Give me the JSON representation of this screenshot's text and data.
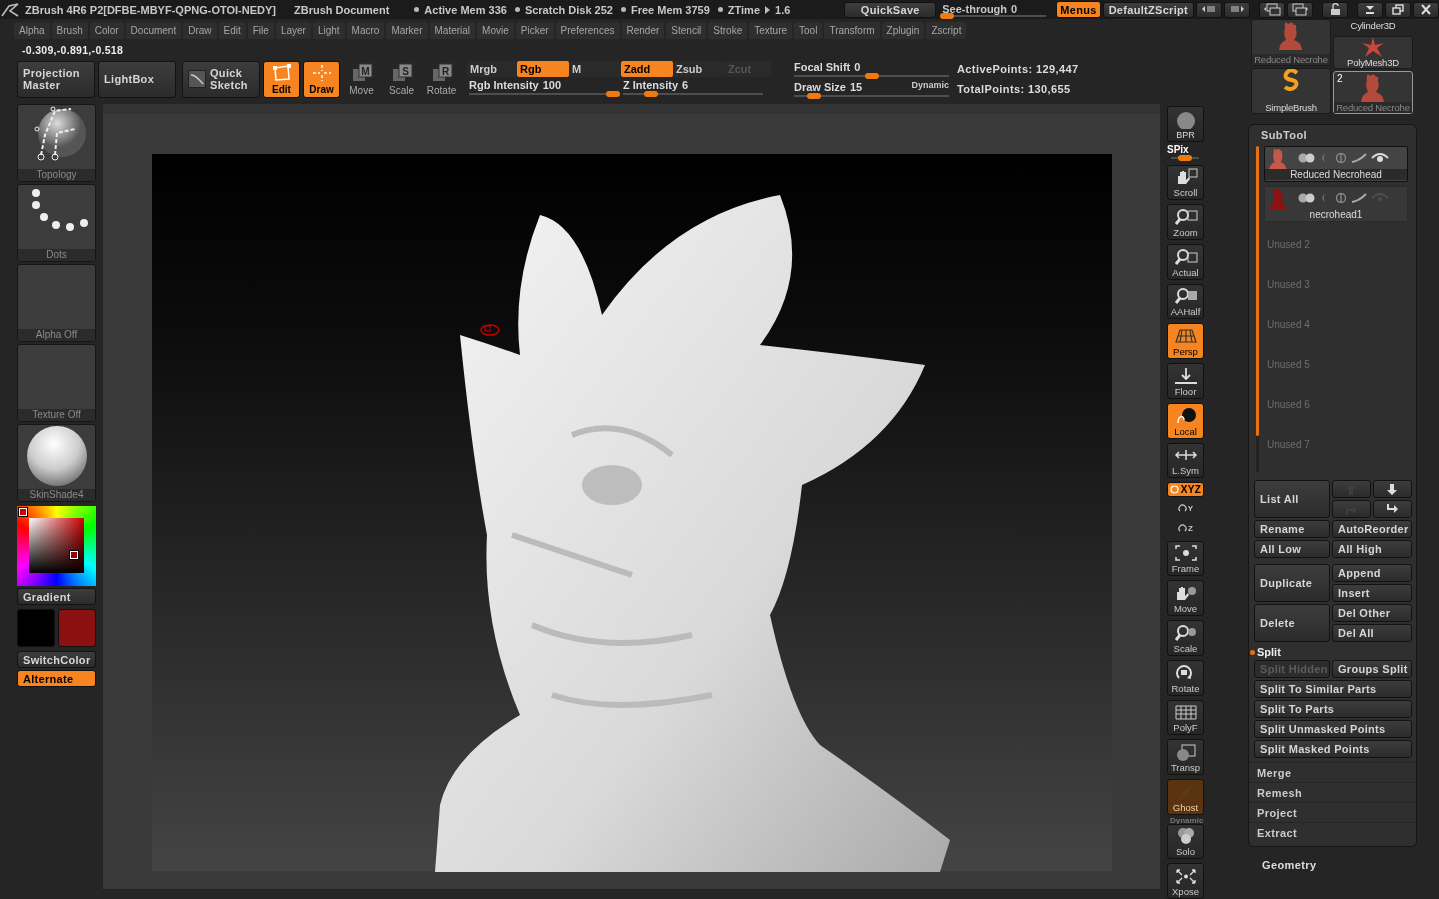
{
  "title_bar": {
    "title": "ZBrush 4R6 P2[DFBE-MBYF-QPNG-OTOI-NEDY]",
    "document": "ZBrush Document",
    "stats": [
      "Active Mem 336",
      "Scratch Disk 252",
      "Free Mem 3759",
      "ZTime"
    ],
    "ztime_value": "1.6",
    "quicksave": "QuickSave",
    "see_through": {
      "label": "See-through",
      "value": "0",
      "level": 0.05
    },
    "menus": {
      "label": "Menus",
      "on": true
    },
    "zscript": "DefaultZScript"
  },
  "menu_bar": [
    "Alpha",
    "Brush",
    "Color",
    "Document",
    "Draw",
    "Edit",
    "File",
    "Layer",
    "Light",
    "Macro",
    "Marker",
    "Material",
    "Movie",
    "Picker",
    "Preferences",
    "Render",
    "Stencil",
    "Stroke",
    "Texture",
    "Tool",
    "Transform",
    "Zplugin",
    "Zscript"
  ],
  "coordinates": "-0.309,-0.891,-0.518",
  "toolbar": {
    "big_buttons": [
      {
        "label": "Projection Master",
        "kind": "projection"
      },
      {
        "label": "LightBox",
        "kind": "lightbox"
      },
      {
        "label": "Quick Sketch",
        "kind": "sketch"
      }
    ],
    "modes": [
      {
        "label": "Edit",
        "kind": "edit",
        "on": true
      },
      {
        "label": "Draw",
        "kind": "draw",
        "on": true
      },
      {
        "label": "Move",
        "kind": "move",
        "key": "M",
        "on": false
      },
      {
        "label": "Scale",
        "kind": "scale",
        "key": "S",
        "on": false
      },
      {
        "label": "Rotate",
        "kind": "rotate",
        "key": "R",
        "on": false
      }
    ],
    "channels": [
      {
        "label": "Mrgb",
        "on": false,
        "disabled": false
      },
      {
        "label": "Rgb",
        "on": true,
        "disabled": false
      },
      {
        "label": "M",
        "on": false,
        "disabled": false
      },
      {
        "label": "Zadd",
        "on": true,
        "disabled": false
      },
      {
        "label": "Zsub",
        "on": false,
        "disabled": false
      },
      {
        "label": "Zcut",
        "on": false,
        "disabled": true
      }
    ],
    "channel_sliders": [
      {
        "label": "Rgb Intensity",
        "value": "100",
        "level": 1
      },
      {
        "label": "Z Intensity",
        "value": "6",
        "level": 0.2
      }
    ],
    "brush_sliders": [
      {
        "label": "Focal Shift",
        "value": "0",
        "level": 0.5
      },
      {
        "label": "Draw Size",
        "value": "15",
        "level": 0.13
      }
    ],
    "dynamic": "Dynamic",
    "stats": [
      "ActivePoints: 129,447",
      "TotalPoints: 130,655"
    ]
  },
  "left_shelf": {
    "tiles": [
      {
        "label": "Topology",
        "kind": "brush"
      },
      {
        "label": "Dots",
        "kind": "stroke"
      },
      {
        "label": "Alpha Off",
        "kind": "alpha"
      },
      {
        "label": "Texture Off",
        "kind": "texture"
      },
      {
        "label": "SkinShade4",
        "kind": "material"
      }
    ],
    "gradient": "Gradient",
    "swatches": [
      {
        "color": "#000000"
      },
      {
        "color": "#8b1010"
      }
    ],
    "switch_color": "SwitchColor",
    "alternate": {
      "label": "Alternate",
      "on": true
    }
  },
  "right_shelf": [
    {
      "label": "BPR",
      "kind": "bpr",
      "on": false,
      "disabled": false
    },
    {
      "label": "SPix",
      "kind": "slider",
      "level": 0.5,
      "on": false,
      "disabled": false
    },
    {
      "label": "Scroll",
      "kind": "scroll",
      "on": false,
      "disabled": false
    },
    {
      "label": "Zoom",
      "kind": "zoom",
      "on": false,
      "disabled": false
    },
    {
      "label": "Actual",
      "kind": "actual",
      "on": false,
      "disabled": false
    },
    {
      "label": "AAHalf",
      "kind": "aahalf",
      "on": false,
      "disabled": false
    },
    {
      "label": "Persp",
      "kind": "persp",
      "on": true,
      "disabled": false
    },
    {
      "label": "Floor",
      "kind": "floor",
      "on": false,
      "disabled": false
    },
    {
      "label": "Local",
      "kind": "local",
      "on": true,
      "disabled": false
    },
    {
      "label": "L.Sym",
      "kind": "lsym",
      "on": false,
      "disabled": false
    },
    {
      "label": "XYZ",
      "kind": "xyz",
      "on": true,
      "disabled": false
    },
    {
      "label": "Y",
      "kind": "axis",
      "on": false,
      "disabled": false
    },
    {
      "label": "Z",
      "kind": "axis",
      "on": false,
      "disabled": false
    },
    {
      "label": "Frame",
      "kind": "frame",
      "on": false,
      "disabled": false
    },
    {
      "label": "Move",
      "kind": "move",
      "on": false,
      "disabled": false
    },
    {
      "label": "Scale",
      "kind": "scale",
      "on": false,
      "disabled": false
    },
    {
      "label": "Rotate",
      "kind": "rotate",
      "on": false,
      "disabled": false
    },
    {
      "label": "PolyF",
      "kind": "polyf",
      "on": false,
      "disabled": false
    },
    {
      "label": "Transp",
      "kind": "transp",
      "on": false,
      "disabled": false
    },
    {
      "label": "Ghost",
      "kind": "ghost",
      "on": true,
      "disabled": true
    },
    {
      "label": "Dynamic",
      "kind": "caption",
      "on": false,
      "disabled": false
    },
    {
      "label": "Solo",
      "kind": "solo",
      "on": false,
      "disabled": false
    },
    {
      "label": "Xpose",
      "kind": "xpose",
      "on": false,
      "disabled": false
    }
  ],
  "tool_palette": {
    "columns": [
      {
        "items": [
          {
            "label": "Reduced Necrohe",
            "kind": "head",
            "selected": false
          },
          {
            "label": "SimpleBrush",
            "kind": "brush",
            "selected": false
          }
        ]
      },
      {
        "items": [
          {
            "label": "Cylinder3D",
            "kind": "cut",
            "selected": false
          },
          {
            "label": "PolyMesh3D",
            "kind": "star",
            "selected": false
          },
          {
            "label": "Reduced Necrohe",
            "kind": "head",
            "badge": "2",
            "selected": true
          }
        ]
      }
    ]
  },
  "subtool": {
    "title": "SubTool",
    "items": [
      {
        "name": "Reduced Necrohead",
        "kind": "mesh",
        "visible": true,
        "selected": true
      },
      {
        "name": "necrohead1",
        "kind": "mesh",
        "visible": false,
        "selected": false
      },
      {
        "name": "Unused 2",
        "kind": "unused",
        "visible": false,
        "selected": false
      },
      {
        "name": "Unused 3",
        "kind": "unused",
        "visible": false,
        "selected": false
      },
      {
        "name": "Unused 4",
        "kind": "unused",
        "visible": false,
        "selected": false
      },
      {
        "name": "Unused 5",
        "kind": "unused",
        "visible": false,
        "selected": false
      },
      {
        "name": "Unused 6",
        "kind": "unused",
        "visible": false,
        "selected": false
      },
      {
        "name": "Unused 7",
        "kind": "unused",
        "visible": false,
        "selected": false
      }
    ],
    "list_all": "List All",
    "arrows": [
      {
        "kind": "up",
        "disabled": true
      },
      {
        "kind": "down",
        "disabled": false
      },
      {
        "kind": "up-right",
        "disabled": true
      },
      {
        "kind": "down-right",
        "disabled": false
      }
    ],
    "pairs": [
      [
        "Rename",
        "AutoReorder"
      ],
      [
        "All Low",
        "All High"
      ]
    ],
    "groups": [
      {
        "main": "Duplicate",
        "side": [
          "Append",
          "Insert"
        ]
      },
      {
        "main": "Delete",
        "side": [
          "Del Other",
          "Del All"
        ]
      }
    ],
    "split": {
      "title": "Split",
      "expanded": true,
      "buttons": [
        {
          "label": "Split Hidden",
          "kind": "half",
          "disabled": true
        },
        {
          "label": "Groups Split",
          "kind": "half",
          "disabled": false
        },
        {
          "label": "Split To Similar Parts",
          "kind": "full",
          "disabled": false
        },
        {
          "label": "Split To Parts",
          "kind": "full",
          "disabled": false
        },
        {
          "label": "Split Unmasked Points",
          "kind": "full",
          "disabled": false
        },
        {
          "label": "Split Masked Points",
          "kind": "full",
          "disabled": false
        }
      ]
    },
    "sections": [
      {
        "title": "Merge",
        "expanded": false
      },
      {
        "title": "Remesh",
        "expanded": false
      },
      {
        "title": "Project",
        "expanded": false
      },
      {
        "title": "Extract",
        "expanded": false
      }
    ]
  },
  "geometry": {
    "title": "Geometry",
    "expanded": false
  }
}
